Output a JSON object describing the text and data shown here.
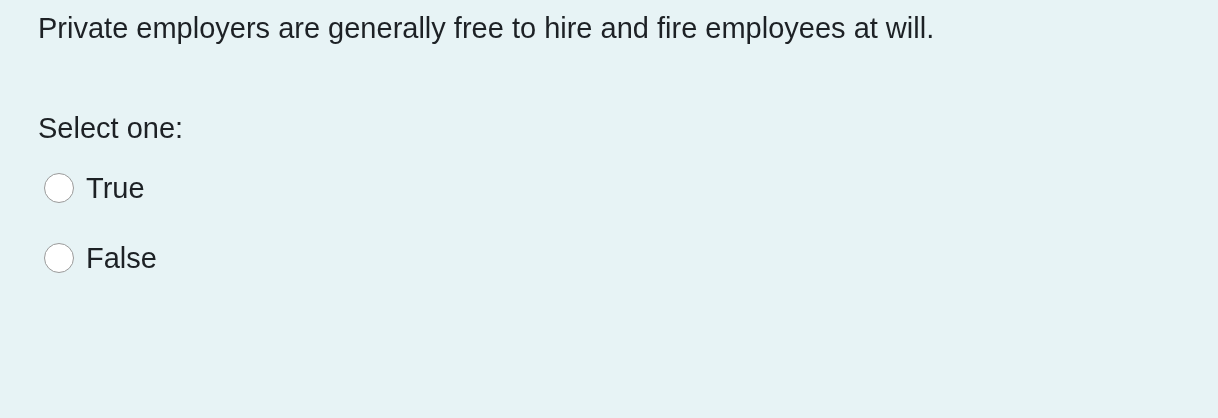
{
  "question": {
    "text": "Private employers are generally free to hire and fire employees at will.",
    "prompt": "Select one:",
    "options": [
      {
        "label": "True",
        "selected": false
      },
      {
        "label": "False",
        "selected": false
      }
    ]
  }
}
